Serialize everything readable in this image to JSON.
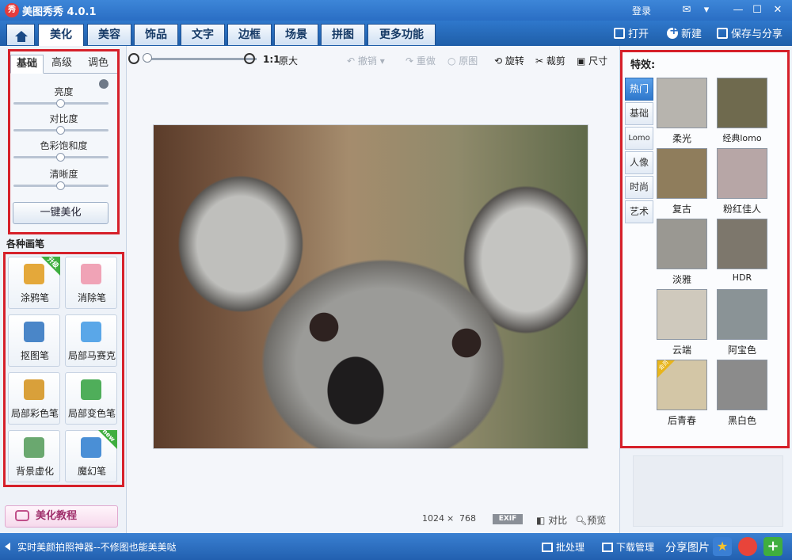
{
  "app": {
    "logo_text": "秀",
    "title": "美图秀秀 4.0.1",
    "login": "登录"
  },
  "main_tabs": [
    {
      "label": "美化",
      "active": true
    },
    {
      "label": "美容"
    },
    {
      "label": "饰品"
    },
    {
      "label": "文字"
    },
    {
      "label": "边框"
    },
    {
      "label": "场景"
    },
    {
      "label": "拼图"
    },
    {
      "label": "更多功能 ▾"
    }
  ],
  "toolbar_right": {
    "open": "打开",
    "new": "新建",
    "save_share": "保存与分享"
  },
  "basic_panel": {
    "subtabs": [
      "基础",
      "高级",
      "调色"
    ],
    "sliders": [
      {
        "label": "亮度",
        "value": 0.5
      },
      {
        "label": "对比度",
        "value": 0.5
      },
      {
        "label": "色彩饱和度",
        "value": 0.5
      },
      {
        "label": "清晰度",
        "value": 0.5
      }
    ],
    "one_click": "一键美化"
  },
  "pens": {
    "title": "各种画笔",
    "items": [
      {
        "label": "涂鸦笔",
        "badge": "升级",
        "color": "#e4a83a"
      },
      {
        "label": "消除笔",
        "color": "#f0a3b6"
      },
      {
        "label": "抠图笔",
        "color": "#4a86c8"
      },
      {
        "label": "局部马赛克",
        "color": "#5aa7e8"
      },
      {
        "label": "局部彩色笔",
        "color": "#d9a03a"
      },
      {
        "label": "局部变色笔",
        "color": "#4fae5a"
      },
      {
        "label": "背景虚化",
        "color": "#6aa86f"
      },
      {
        "label": "魔幻笔",
        "badge": "new",
        "color": "#4a8fd6"
      }
    ]
  },
  "tutorial": "美化教程",
  "center_toolbar": {
    "ratio": "1:1",
    "original_size": "原大",
    "undo": "撤销",
    "redo": "重做",
    "original": "原图",
    "rotate": "旋转",
    "crop": "裁剪",
    "size": "尺寸"
  },
  "photo_info": {
    "width": "1024",
    "times": "×",
    "height": "768",
    "exif": "EXIF",
    "compare": "对比",
    "preview": "预览"
  },
  "effects": {
    "title": "特效:",
    "categories": [
      {
        "label": "热门",
        "active": true
      },
      {
        "label": "基础"
      },
      {
        "label": "Lomo"
      },
      {
        "label": "人像"
      },
      {
        "label": "时尚"
      },
      {
        "label": "艺术"
      }
    ],
    "items": [
      {
        "label": "柔光",
        "tint": "#b7b4ae"
      },
      {
        "label": "经典lomo",
        "tint": "#6f6a4e"
      },
      {
        "label": "复古",
        "tint": "#8f7d5c"
      },
      {
        "label": "粉红佳人",
        "tint": "#b7a6a6"
      },
      {
        "label": "淡雅",
        "tint": "#9a9892"
      },
      {
        "label": "HDR",
        "tint": "#7d776c"
      },
      {
        "label": "云端",
        "tint": "#cfc9bd"
      },
      {
        "label": "阿宝色",
        "tint": "#8a9396"
      },
      {
        "label": "后青春",
        "tint": "#d3c6a6",
        "badge": "会员"
      },
      {
        "label": "黑白色",
        "tint": "#8b8b8b"
      }
    ]
  },
  "statusbar": {
    "message": "实时美颜拍照神器--不修图也能美美哒",
    "batch": "批处理",
    "download": "下载管理",
    "share": "分享图片"
  },
  "colors": {
    "accent": "#2f78cc",
    "highlight_border": "#d6202a"
  }
}
